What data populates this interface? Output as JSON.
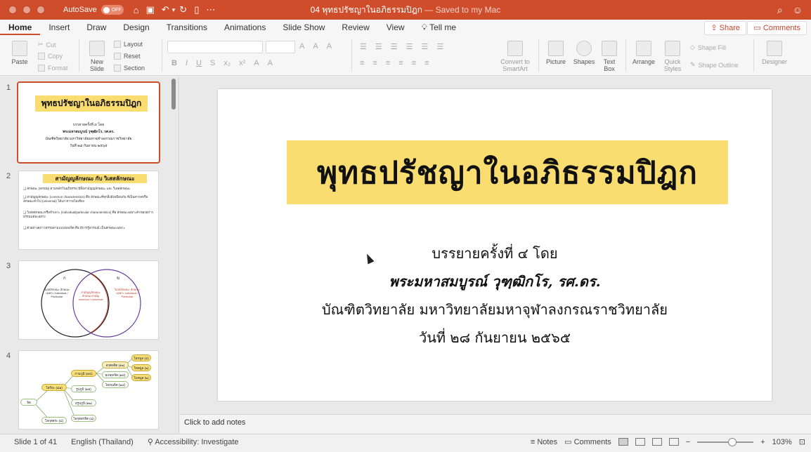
{
  "titlebar": {
    "autosave_label": "AutoSave",
    "autosave_state": "OFF",
    "document_name": "04 พุทธปรัชญาในอภิธรรมปิฎก",
    "saved_status": "— Saved to my Mac"
  },
  "ribbon_tabs": [
    "Home",
    "Insert",
    "Draw",
    "Design",
    "Transitions",
    "Animations",
    "Slide Show",
    "Review",
    "View",
    "Tell me"
  ],
  "share_label": "Share",
  "comments_label": "Comments",
  "ribbon": {
    "paste": "Paste",
    "cut": "Cut",
    "copy": "Copy",
    "format": "Format",
    "new_slide": "New Slide",
    "layout": "Layout",
    "reset": "Reset",
    "section": "Section",
    "convert_smartart": "Convert to SmartArt",
    "picture": "Picture",
    "shapes": "Shapes",
    "text_box": "Text Box",
    "arrange": "Arrange",
    "quick_styles": "Quick Styles",
    "shape_fill": "Shape Fill",
    "shape_outline": "Shape Outline",
    "designer": "Designer"
  },
  "thumbnails": {
    "numbers": [
      "1",
      "2",
      "3",
      "4"
    ],
    "slide1": {
      "title": "พุทธปรัชญาในอภิธรรมปิฎก",
      "lines": [
        "บรรยายครั้งที่ ๔ โดย",
        "พระมหาสมบูรณ์ วุฑฺฒิกโร, รศ.ดร.",
        "บัณฑิตวิทยาลัย มหาวิทยาลัยมหาจุฬาลงกรณราชวิทยาลัย",
        "วันที่ ๒๘ กันยายน ๒๕๖๕"
      ]
    },
    "slide2": {
      "title": "สามัญญลักษณะ กับ วิเสสลักษณะ",
      "bullets": [
        "❑ ลักษณะ (ลกฺขณ) ตามหลักในอภิธรรม มีทั้งสามัญญลักษณะ และ วิเสสลักษณะ",
        "❑ สามัญญลักษณะ (common characteristics) คือ ลักษณะที่ทุกสิ่งมีเหมือนกัน ที่เป็นสากลหรือลักษณะทั่วไป (universal) ได้แก่ ความไม่เที่ยง",
        "❑ วิเสสลักษณะหรือจำเพาะ (individual/particular characteristics) คือ ลักษณะเฉพาะตัวของสภาวธรรมแต่ละอย่าง",
        "❑ ตัวอย่างสภาวธรรมตามแบบของจิต คือ มีการรู้อารมณ์ เป็นลักษณะเฉพาะ"
      ]
    },
    "slide3": {
      "left_tag": "ก",
      "right_tag": "ข",
      "left_text": "วิเสสลักษณะ ลักษณะเฉพาะ individual / Particular",
      "middle_text": "สามัญญลักษณะ ลักษณะสามัญ common / universal",
      "right_text": "วิเสสลักษณะ ลักษณะเฉพาะ individual / Particular"
    },
    "slide4": {
      "nodes": [
        "จิต",
        "โลกิยะ (๘๑)",
        "โลกุตตระ (๘)",
        "กามภูมิ (๕๔)",
        "รูปภูมิ (๑๕)",
        "อรูปภูมิ (๑๒)",
        "โลกุตตรจิต (๘)",
        "อกุศลจิต (๑๒)",
        "อเหตุกจิต (๑๘)",
        "โสภณจิต (๒๔)",
        "โลภมูล (๘)",
        "โทสมูล (๒)",
        "โมหมูล (๒)"
      ]
    }
  },
  "slide": {
    "title": "พุทธปรัชญาในอภิธรรมปิฎก",
    "line1": "บรรยายครั้งที่ ๔ โดย",
    "line2": "พระมหาสมบูรณ์ วุฑฺฒิกโร, รศ.ดร.",
    "line3": "บัณฑิตวิทยาลัย มหาวิทยาลัยมหาจุฬาลงกรณราชวิทยาลัย",
    "line4": "วันที่ ๒๘ กันยายน ๒๕๖๕",
    "accent_color": "#fadd71"
  },
  "notes_placeholder": "Click to add notes",
  "statusbar": {
    "slide_counter": "Slide 1 of 41",
    "language": "English (Thailand)",
    "accessibility": "Accessibility: Investigate",
    "notes": "Notes",
    "comments": "Comments",
    "zoom": "103%"
  },
  "colors": {
    "brand": "#d04d2b",
    "highlight": "#fadd71"
  }
}
